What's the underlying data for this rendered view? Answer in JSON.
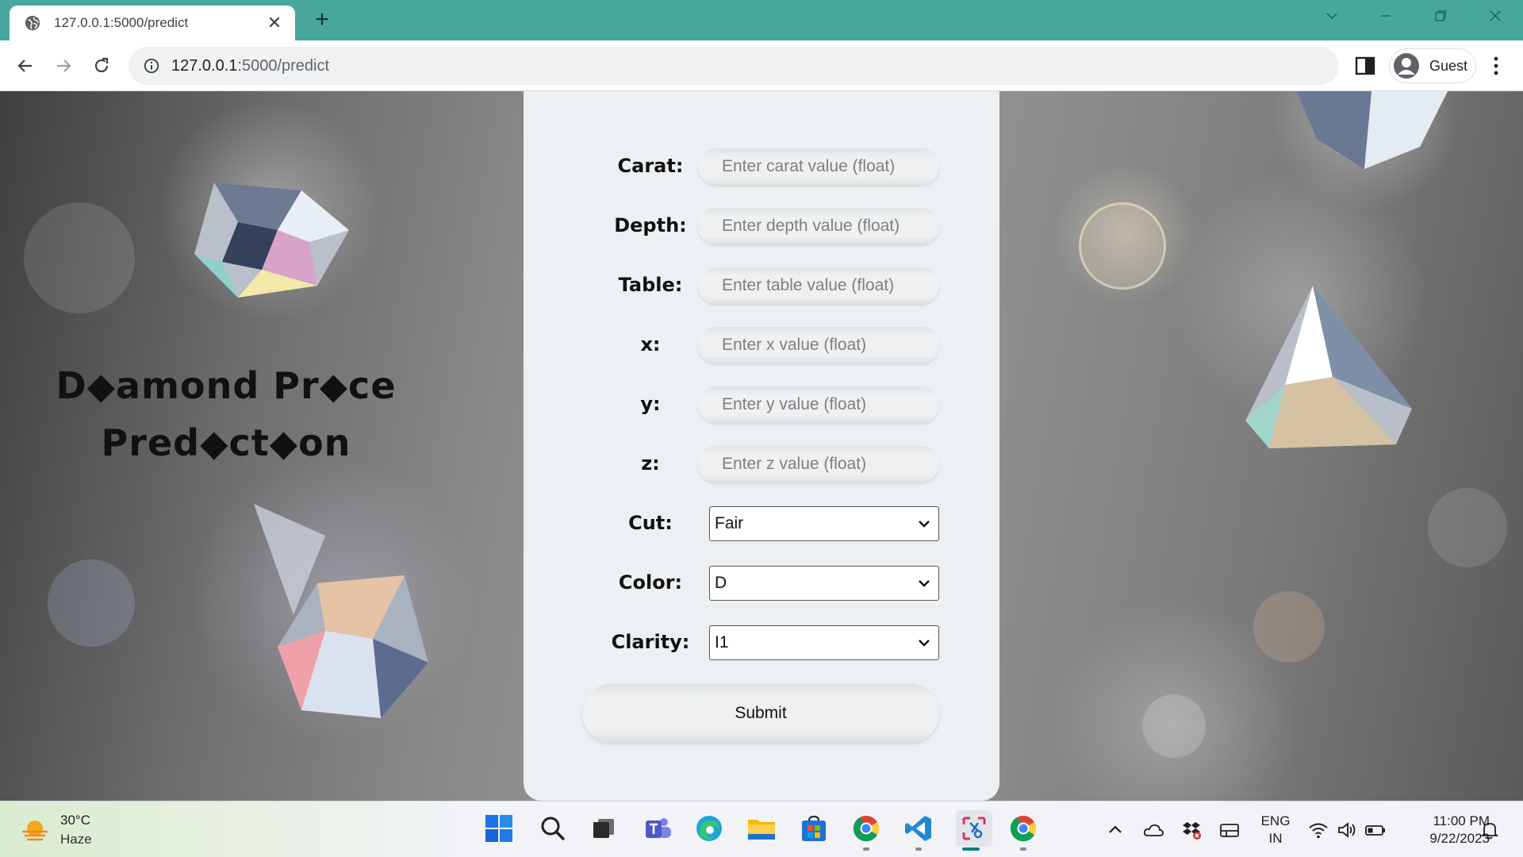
{
  "browser": {
    "tab_title": "127.0.0.1:5000/predict",
    "url_host": "127.0.0.1",
    "url_rest": ":5000/predict",
    "profile_label": "Guest"
  },
  "page": {
    "heading_line1": "D◆amond Pr◆ce",
    "heading_line2": "Pred◆ct◆on",
    "form": {
      "carat_label": "Carat:",
      "carat_placeholder": "Enter carat value (float)",
      "depth_label": "Depth:",
      "depth_placeholder": "Enter depth value (float)",
      "table_label": "Table:",
      "table_placeholder": "Enter table value (float)",
      "x_label": "x:",
      "x_placeholder": "Enter x value (float)",
      "y_label": "y:",
      "y_placeholder": "Enter y value (float)",
      "z_label": "z:",
      "z_placeholder": "Enter z value (float)",
      "cut_label": "Cut:",
      "cut_value": "Fair",
      "color_label": "Color:",
      "color_value": "D",
      "clarity_label": "Clarity:",
      "clarity_value": "I1",
      "submit_label": "Submit"
    }
  },
  "taskbar": {
    "temperature": "30°C",
    "condition": "Haze",
    "lang_line1": "ENG",
    "lang_line2": "IN",
    "time": "11:00 PM",
    "date": "9/22/2023"
  },
  "colors": {
    "titlebar": "#48a79c",
    "card": "#edf0f2",
    "heading": "#111111"
  }
}
